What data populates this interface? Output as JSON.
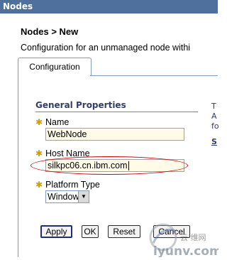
{
  "window": {
    "title": "Nodes"
  },
  "breadcrumb": "Nodes > New",
  "description": "Configuration for an unmanaged node withi",
  "tabs": [
    {
      "label": "Configuration"
    }
  ],
  "section": {
    "title": "General Properties",
    "side_text": [
      "T",
      "A",
      "fo",
      "S"
    ]
  },
  "fields": {
    "name": {
      "label": "Name",
      "value": "WebNode",
      "required": true
    },
    "host_name": {
      "label": "Host Name",
      "value": "silkpc06.cn.ibm.com",
      "required": true
    },
    "platform_type": {
      "label": "Platform Type",
      "selected": "Windows",
      "required": true
    }
  },
  "buttons": {
    "apply": "Apply",
    "ok": "OK",
    "reset": "Reset",
    "cancel": "Cancel"
  },
  "watermark": {
    "text": "iyunv.com",
    "sub_text": "云·维网"
  },
  "colors": {
    "titlebar": "#4f6f9c",
    "section_title": "#333d6b",
    "required_star": "#c8a000",
    "field_background": "#fffbe6",
    "highlight_ellipse": "#d40000"
  }
}
